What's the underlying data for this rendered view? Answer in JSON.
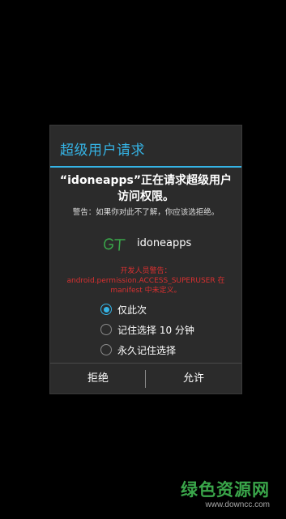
{
  "dialog": {
    "title": "超级用户请求",
    "request_message": "“idoneapps”正在请求超级用户访问权限。",
    "warning": "警告：如果你对此不了解，你应该选拒绝。",
    "app": {
      "icon": "gt-app-icon",
      "name": "idoneapps"
    },
    "developer_warning": "开发人员警告：android.permission.ACCESS_SUPERUSER 在 manifest 中未定义。",
    "options": [
      {
        "label": "仅此次",
        "checked": true
      },
      {
        "label": "记住选择 10 分钟",
        "checked": false
      },
      {
        "label": "永久记住选择",
        "checked": false
      }
    ],
    "buttons": {
      "deny": "拒绝",
      "allow": "允许"
    }
  },
  "watermark": {
    "main": "绿色资源网",
    "url": "www.downcc.com"
  },
  "colors": {
    "accent": "#35b4e6",
    "dialog_bg": "#2b2b2b",
    "warning_red": "#d93030",
    "watermark_green": "#3aa64a"
  }
}
